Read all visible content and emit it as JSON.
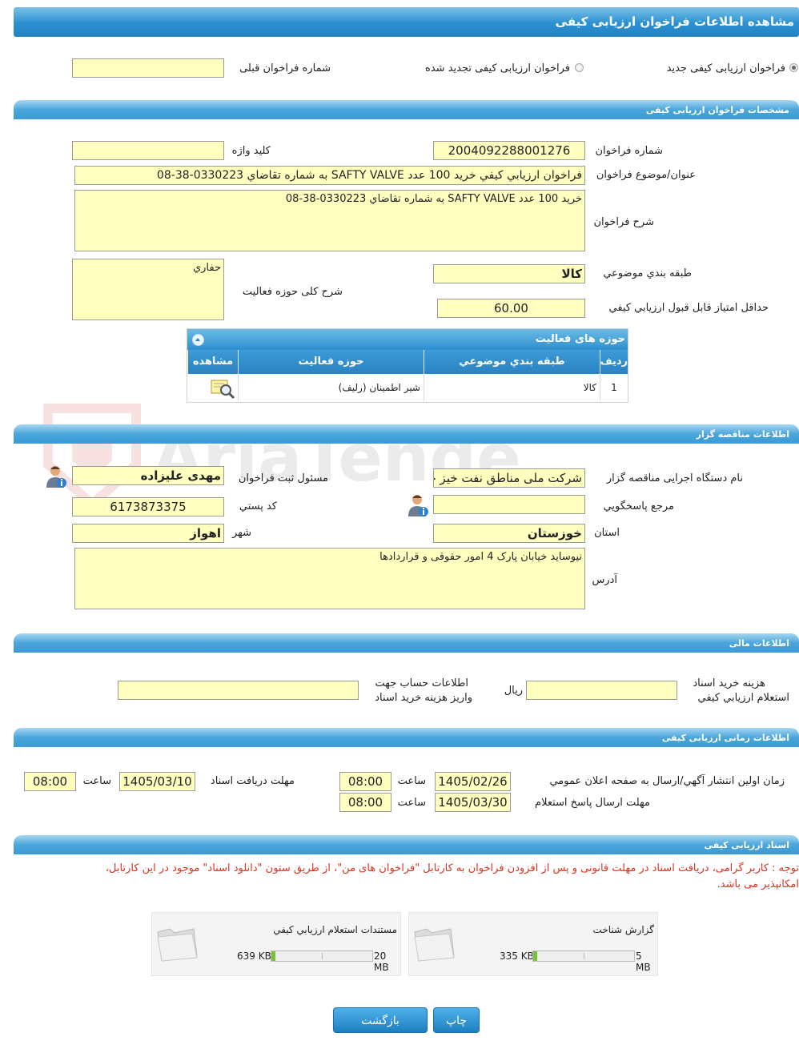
{
  "header": {
    "title": "مشاهده اطلاعات فراخوان ارزیابی کیفی"
  },
  "top": {
    "radio_new": "فراخوان ارزیابی کیفی جدید",
    "radio_renewed": "فراخوان ارزیابی کیفی تجدید شده",
    "prev_number_label": "شماره فراخوان قبلی",
    "prev_number_value": ""
  },
  "spec": {
    "section_title": "مشخصات فراخوان ارزیابی کیفی",
    "number_label": "شماره فراخوان",
    "number_value": "2004092288001276",
    "keyword_label": "کلید واژه",
    "keyword_value": "",
    "subject_label": "عنوان/موضوع فراخوان",
    "subject_value": "فراخوان ارزيابي كيفي خريد 100 عدد SAFTY VALVE به شماره تقاضاي 0330223-38-08",
    "desc_label": "شرح فراخوان",
    "desc_value": "خريد 100 عدد SAFTY VALVE به شماره تقاضاي 0330223-38-08",
    "category_label": "طبقه بندي موضوعي",
    "category_value": "كالا",
    "activity_desc_label": "شرح کلی حوزه فعالیت",
    "activity_desc_value": "حفاري",
    "min_score_label": "حداقل امتیاز قابل قبول ارزيابي کيفي",
    "min_score_value": "60.00"
  },
  "activities": {
    "title": "حوزه های فعالیت",
    "columns": [
      "رديف",
      "طبقه بندي موضوعي",
      "حوزه فعالیت",
      "مشاهده"
    ],
    "rows": [
      {
        "row": "1",
        "category": "كالا",
        "field": "شير اطمينان (رليف)"
      }
    ]
  },
  "organizer": {
    "section_title": "اطلاعات مناقصه گزار",
    "org_label": "نام دستگاه اجرایی مناقصه گزار",
    "org_value": "شرکت ملی مناطق نفت خیز جنوب",
    "registrar_label": "مسئول ثبت فراخوان",
    "registrar_value": "مهدی علیزاده",
    "responder_label": "مرجع پاسخگويي",
    "responder_value": "",
    "postal_label": "کد پستي",
    "postal_value": "6173873375",
    "province_label": "استان",
    "province_value": "خوزستان",
    "city_label": "شهر",
    "city_value": "اهواز",
    "address_label": "آدرس",
    "address_value": "نيوسايد خيابان پارک 4 امور حقوقی و قراردادها"
  },
  "financial": {
    "section_title": "اطلاعات مالی",
    "fee_label_1": "هزينه خريد اسناد",
    "fee_label_2": "استعلام ارزيابي کيفي",
    "fee_value": "",
    "currency": "ريال",
    "account_label_1": "اطلاعات حساب جهت",
    "account_label_2": "واريز هزينه خريد اسناد",
    "account_value": ""
  },
  "timing": {
    "section_title": "اطلاعات زمانی ارزیابی کیفی",
    "publish_label": "زمان اولین انتشار آگهي/ارسال به صفحه اعلان عمومي",
    "publish_date": "1405/02/26",
    "publish_time": "08:00",
    "receive_label": "مهلت دریافت اسناد",
    "receive_date": "1405/03/10",
    "receive_time": "08:00",
    "reply_label": "مهلت ارسال پاسخ استعلام",
    "reply_date": "1405/03/30",
    "reply_time": "08:00",
    "time_label": "ساعت"
  },
  "documents": {
    "section_title": "اسناد ارزیابی کیفی",
    "note_line1": "توجه : کاربر گرامی، دریافت اسناد در مهلت قانونی و پس از افزودن فراخوان به کارتابل \"فراخوان های من\"، از طریق ستون \"دانلود اسناد\" موجود در این کارتابل،",
    "note_line2": "امکانپذیر می باشد.",
    "items": [
      {
        "title": "گزارش شناخت",
        "size": "335 KB",
        "max": "5 MB",
        "fill": 0.02
      },
      {
        "title": "مستندات استعلام ارزيابي کيفي",
        "size": "639 KB",
        "max": "20 MB",
        "fill": 0.02
      }
    ]
  },
  "buttons": {
    "print": "چاپ",
    "back": "بازگشت"
  },
  "watermark": "AriaTender.neT",
  "colors": {
    "accent": "#2a8fd0",
    "field_bg": "#ffffc0",
    "note": "#e0301e"
  }
}
